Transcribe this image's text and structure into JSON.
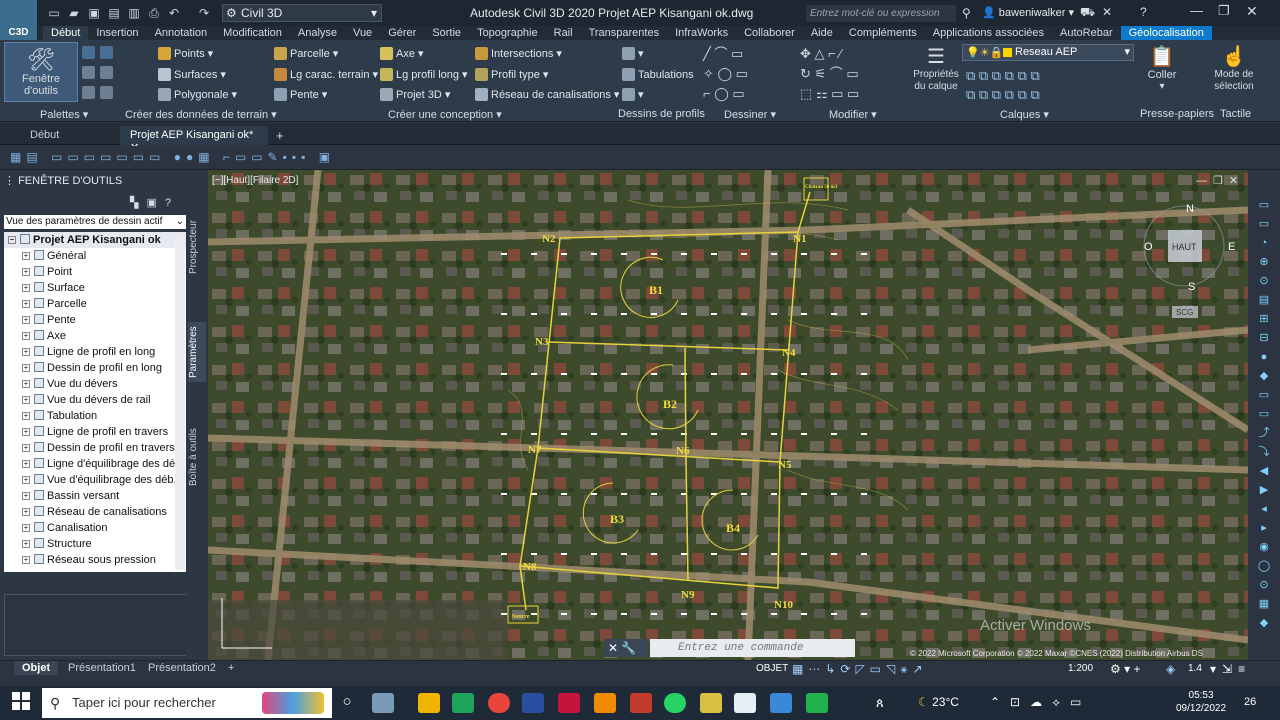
{
  "titlebar": {
    "app_badge": "C3D",
    "workspace": "Civil 3D",
    "title": "Autodesk Civil 3D 2020   Projet AEP Kisangani ok.dwg",
    "search_placeholder": "Entrez mot-clé ou expression",
    "user": "baweniwalker"
  },
  "ribbon_tabs": [
    "Début",
    "Insertion",
    "Annotation",
    "Modification",
    "Analyse",
    "Vue",
    "Gérer",
    "Sortie",
    "Topographie",
    "Rail",
    "Transparentes",
    "InfraWorks",
    "Collaborer",
    "Aide",
    "Compléments",
    "Applications associées",
    "AutoRebar",
    "Géolocalisation"
  ],
  "ribbon": {
    "palettes": {
      "big_button": "Fenêtre d'outils",
      "title": "Palettes"
    },
    "create_ground": {
      "items": [
        "Points",
        "Surfaces",
        "Polygonale"
      ],
      "title": "Créer des données de terrain"
    },
    "create_design": {
      "col1": [
        "Parcelle",
        "Lg carac. terrain",
        "Pente"
      ],
      "col2": [
        "Axe",
        "Lg profil long",
        "Projet 3D"
      ],
      "col3": [
        "Intersections",
        "Profil type",
        "Réseau de canalisations"
      ],
      "title": "Créer une conception"
    },
    "profile_views": {
      "items": [
        "Tabulations"
      ],
      "title": "Dessins de profils"
    },
    "draw": {
      "title": "Dessiner"
    },
    "modify": {
      "title": "Modifier"
    },
    "layers": {
      "props_label": "Propriétés du calque",
      "current_layer": "Reseau AEP",
      "title": "Calques"
    },
    "clipboard": {
      "label": "Coller",
      "title": "Presse-papiers"
    },
    "touch": {
      "label": "Mode de sélection",
      "title": "Tactile"
    }
  },
  "doc_tabs": [
    "Début",
    "Projet AEP Kisangani ok*"
  ],
  "toolspace": {
    "title": "FENÊTRE D'OUTILS",
    "view": "Vue des paramètres de dessin actif",
    "root": "Projet AEP Kisangani ok",
    "items": [
      "Général",
      "Point",
      "Surface",
      "Parcelle",
      "Pente",
      "Axe",
      "Ligne de profil en long",
      "Dessin de profil en long",
      "Vue du dévers",
      "Vue du dévers de rail",
      "Tabulation",
      "Ligne de profil en travers",
      "Dessin de profil en travers",
      "Ligne d'équilibrage des dé...",
      "Vue d'équilibrage des déb...",
      "Bassin versant",
      "Réseau de canalisations",
      "Canalisation",
      "Structure",
      "Réseau sous pression"
    ],
    "side_tabs": [
      "Prospecteur",
      "Paramètres",
      "Boîte à outils"
    ]
  },
  "viewport": {
    "label": "[−][Haut][Filaire 2D]",
    "nodes": [
      "N1",
      "N2",
      "N3",
      "N4",
      "N5",
      "N6",
      "N7",
      "N8",
      "N9",
      "N10"
    ],
    "blocks": [
      "B1",
      "B2",
      "B3",
      "B4"
    ],
    "tag_top": "Chateau 50 m3",
    "tag_source": "Source",
    "compass": [
      "N",
      "S",
      "E",
      "O",
      "HAUT",
      "SCG"
    ],
    "cmd_placeholder": "Entrez une commande",
    "watermark": "Activer Windows",
    "copyright": "© 2022 Microsoft Corporation © 2022 Maxar ©CNES (2022) Distribution Airbus DS"
  },
  "layout_tabs": [
    "Objet",
    "Présentation1",
    "Présentation2"
  ],
  "status": {
    "space": "OBJET",
    "scale": "1:200",
    "lineweight": "1.4"
  },
  "taskbar": {
    "search": "Taper ici pour rechercher",
    "temp": "23°C",
    "time": "05:53",
    "date": "09/12/2022",
    "notifications": "26"
  },
  "colors": {
    "geo_tab": "#0e7acb",
    "ribbon_bg": "#2d3b4a",
    "design_lines": "#e6d23a",
    "layer_swatch": "#ffd400"
  }
}
